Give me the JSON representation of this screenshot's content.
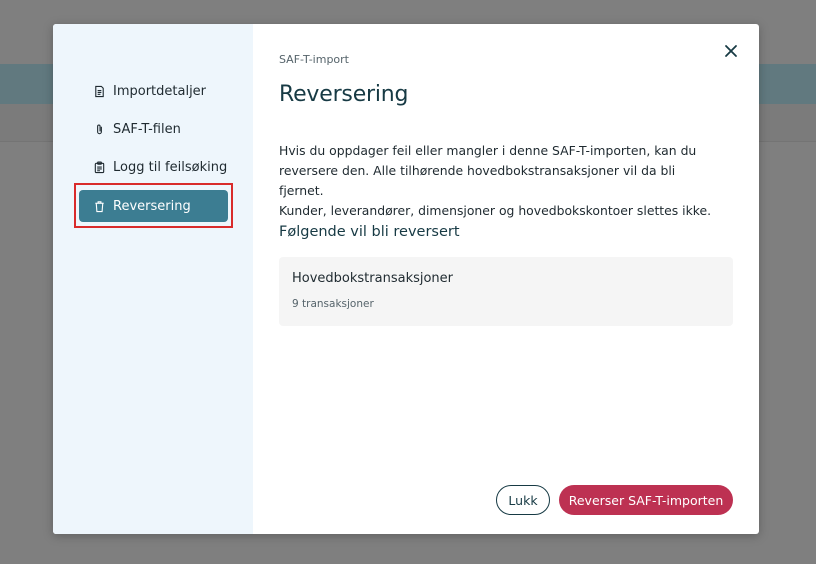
{
  "sidebar": {
    "items": [
      {
        "label": "Importdetaljer",
        "icon": "document-icon"
      },
      {
        "label": "SAF-T-filen",
        "icon": "paperclip-icon"
      },
      {
        "label": "Logg til feilsøking",
        "icon": "clipboard-icon"
      },
      {
        "label": "Reversering",
        "icon": "trash-icon",
        "active": true
      }
    ]
  },
  "dialog": {
    "eyebrow": "SAF-T-import",
    "title": "Reversering",
    "description_lines": [
      "Hvis du oppdager feil eller mangler i denne SAF-T-importen, kan du",
      "reversere den. Alle tilhørende hovedbokstransaksjoner vil da bli fjernet.",
      "Kunder, leverandører, dimensjoner og hovedbokskontoer slettes ikke."
    ],
    "section_title": "Følgende vil bli reversert",
    "card": {
      "title": "Hovedbokstransaksjoner",
      "subtitle": "9 transaksjoner"
    },
    "buttons": {
      "close_label": "Lukk",
      "primary_label": "Reverser SAF-T-importen"
    }
  },
  "colors": {
    "accent": "#3c7d92",
    "primary_button": "#bd3152",
    "sidebar_bg": "#eef6fc",
    "highlight": "#d92b2b"
  }
}
